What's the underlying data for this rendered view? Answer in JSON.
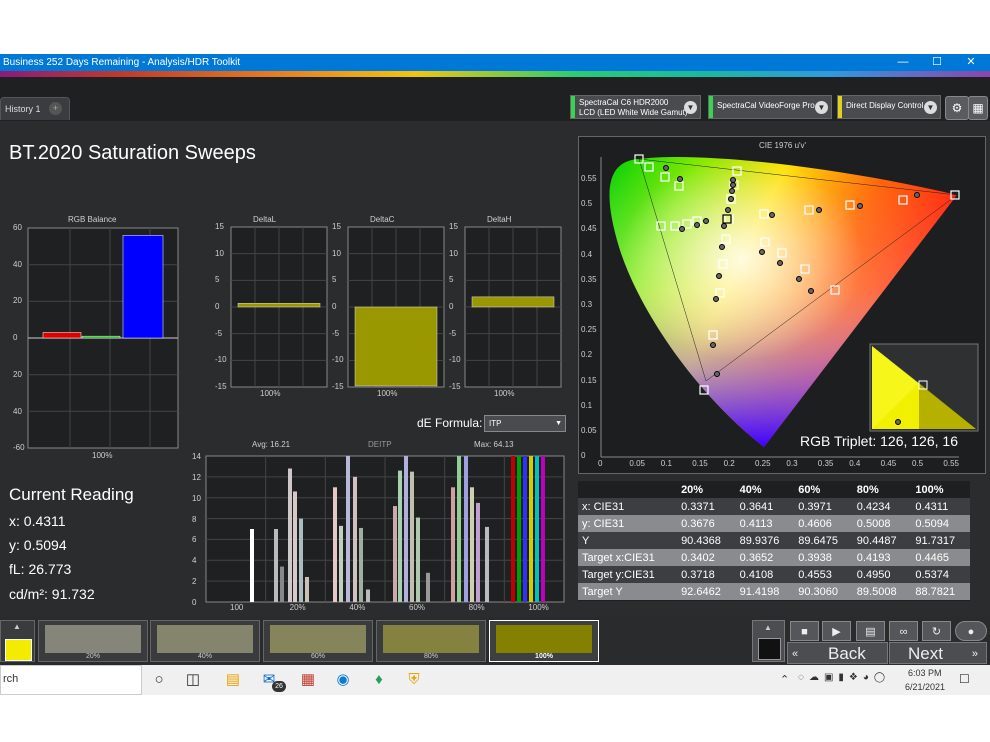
{
  "window": {
    "title": "Business 252 Days Remaining  - Analysis/HDR Toolkit",
    "minimize": "—",
    "maximize": "☐",
    "close": "✕"
  },
  "tabs": [
    {
      "label": "History 1"
    }
  ],
  "tab_add_icon": "+",
  "devices": [
    {
      "line1": "SpectraCal C6 HDR2000",
      "line2": "LCD (LED White Wide Gamut)",
      "color": "#39d353"
    },
    {
      "line1": "SpectraCal VideoForge Pro",
      "line2": "",
      "color": "#39d353"
    },
    {
      "line1": "Direct Display Control",
      "line2": "",
      "color": "#e0d020"
    }
  ],
  "page_title": "BT.2020 Saturation Sweeps",
  "rgb_balance": {
    "title": "RGB Balance",
    "category": "100%",
    "yticks": [
      "60",
      "40",
      "20",
      "0",
      "20",
      "40",
      "-60"
    ],
    "values": {
      "r": 3,
      "g": 1,
      "b": 56
    }
  },
  "delta_charts": [
    {
      "title": "DeltaL",
      "category": "100%",
      "value": 0.7
    },
    {
      "title": "DeltaC",
      "category": "100%",
      "value": -14.8
    },
    {
      "title": "DeltaH",
      "category": "100%",
      "value": 1.9
    }
  ],
  "delta_yticks": [
    "15",
    "10",
    "5",
    "0",
    "-5",
    "-10",
    "-15"
  ],
  "de_formula": {
    "label": "dE Formula:",
    "value": "ITP"
  },
  "detp": {
    "title": "DEITP",
    "avg": "Avg: 16.21",
    "max": "Max: 64.13",
    "yticks": [
      "14",
      "12",
      "10",
      "8",
      "6",
      "4",
      "2",
      "0"
    ],
    "xticks": [
      "100",
      "20%",
      "40%",
      "60%",
      "80%",
      "100%"
    ]
  },
  "current_reading": {
    "title": "Current Reading",
    "x": "x: 0.4311",
    "y": "y: 0.5094",
    "fl": "fL: 26.773",
    "cdm2": "cd/m²: 91.732"
  },
  "cie": {
    "title": "CIE 1976 u'v'",
    "xticks": [
      "0",
      "0.05",
      "0.1",
      "0.15",
      "0.2",
      "0.25",
      "0.3",
      "0.35",
      "0.4",
      "0.45",
      "0.5",
      "0.55"
    ],
    "yticks": [
      "0.55",
      "0.5",
      "0.45",
      "0.4",
      "0.35",
      "0.3",
      "0.25",
      "0.2",
      "0.15",
      "0.1",
      "0.05",
      "0"
    ],
    "rgb_triplet": "RGB Triplet: 126, 126, 16"
  },
  "table": {
    "headers": [
      "",
      "20%",
      "40%",
      "60%",
      "80%",
      "100%"
    ],
    "rows": [
      [
        "x: CIE31",
        "0.3371",
        "0.3641",
        "0.3971",
        "0.4234",
        "0.4311"
      ],
      [
        "y: CIE31",
        "0.3676",
        "0.4113",
        "0.4606",
        "0.5008",
        "0.5094"
      ],
      [
        "Y",
        "90.4368",
        "89.9376",
        "89.6475",
        "90.4487",
        "91.7317"
      ],
      [
        "Target x:CIE31",
        "0.3402",
        "0.3652",
        "0.3938",
        "0.4193",
        "0.4465"
      ],
      [
        "Target y:CIE31",
        "0.3718",
        "0.4108",
        "0.4553",
        "0.4950",
        "0.5374"
      ],
      [
        "Target Y",
        "92.6462",
        "91.4198",
        "90.3060",
        "89.5008",
        "88.7821"
      ]
    ]
  },
  "swatches": [
    {
      "label": "",
      "color": "#f4ec00"
    },
    {
      "label": "20%",
      "color": "#86857a"
    },
    {
      "label": "40%",
      "color": "#85846c"
    },
    {
      "label": "60%",
      "color": "#86845a"
    },
    {
      "label": "80%",
      "color": "#858240"
    },
    {
      "label": "100%",
      "color": "#848000"
    }
  ],
  "nav": {
    "back": "Back",
    "next": "Next"
  },
  "taskbar": {
    "search": "rch",
    "time": "6:03 PM",
    "date": "6/21/2021",
    "mail_badge": "26"
  }
}
